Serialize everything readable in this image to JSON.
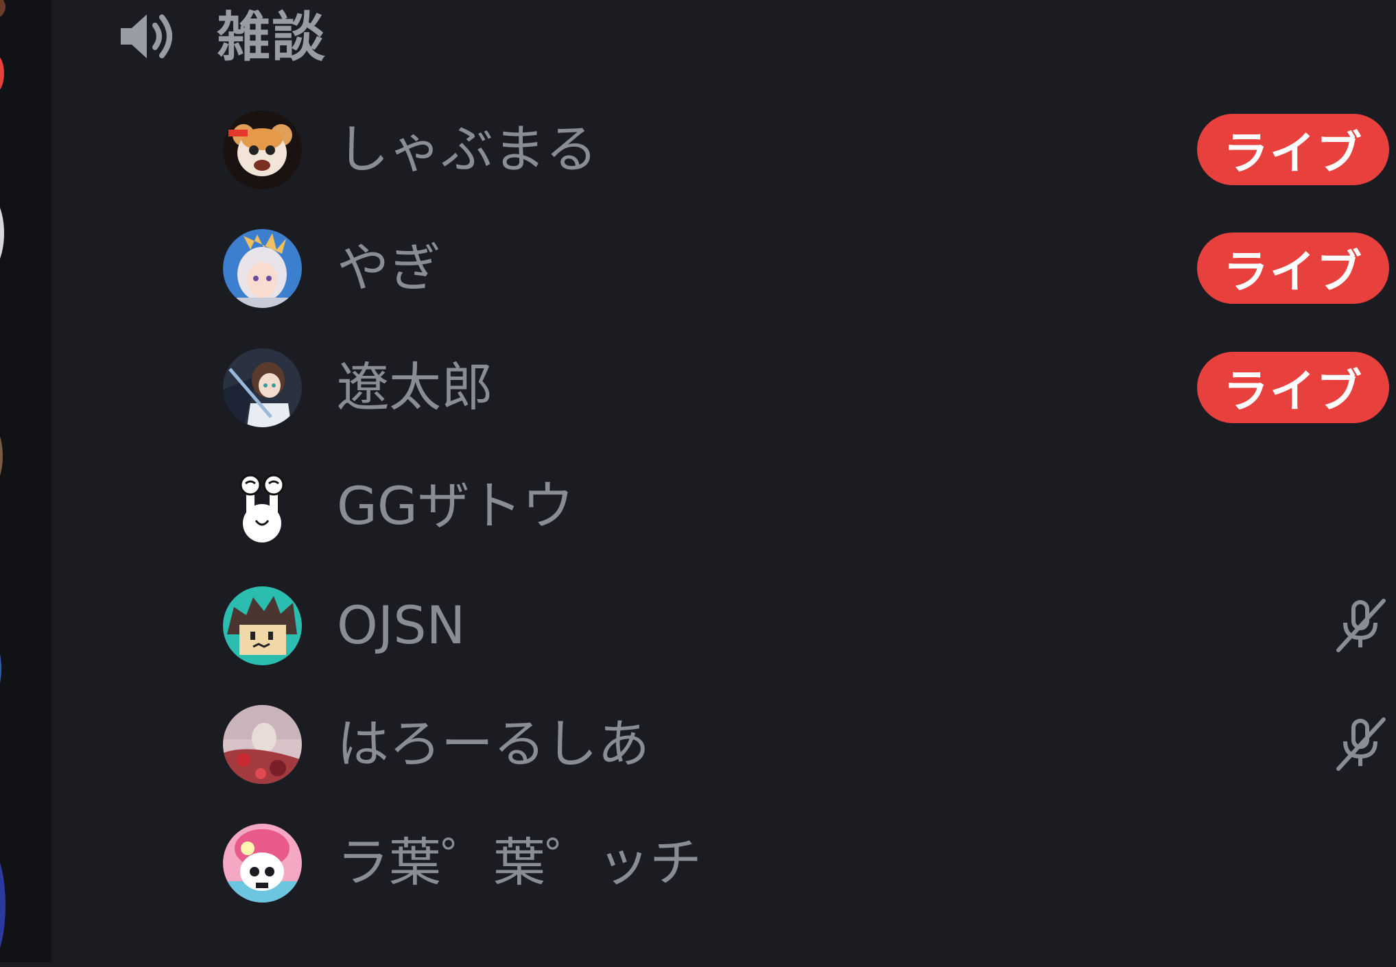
{
  "channel": {
    "name": "雑談",
    "icon": "speaker-icon"
  },
  "members": [
    {
      "name": "しゃぶまる",
      "status": "live",
      "badge": "ライブ",
      "avatar_icon": "hamster-avatar"
    },
    {
      "name": "やぎ",
      "status": "live",
      "badge": "ライブ",
      "avatar_icon": "anime-girl-avatar"
    },
    {
      "name": "遼太郎",
      "status": "live",
      "badge": "ライブ",
      "avatar_icon": "anime-swordsman-avatar"
    },
    {
      "name": "GGザトウ",
      "status": "none",
      "avatar_icon": "white-creature-avatar"
    },
    {
      "name": "OJSN",
      "status": "muted",
      "avatar_icon": "pixel-face-avatar",
      "status_icon": "mic-muted-icon"
    },
    {
      "name": "はろーるしあ",
      "status": "muted",
      "avatar_icon": "art-scene-avatar",
      "status_icon": "mic-muted-icon"
    },
    {
      "name": "ラ葉゜葉゜ッチ",
      "status": "none",
      "avatar_icon": "pink-skull-avatar"
    }
  ],
  "colors": {
    "background": "#1b1c22",
    "rail": "#111216",
    "live_badge": "#e8413d",
    "text": "#8b8d95",
    "icon": "#9a9ca3"
  }
}
